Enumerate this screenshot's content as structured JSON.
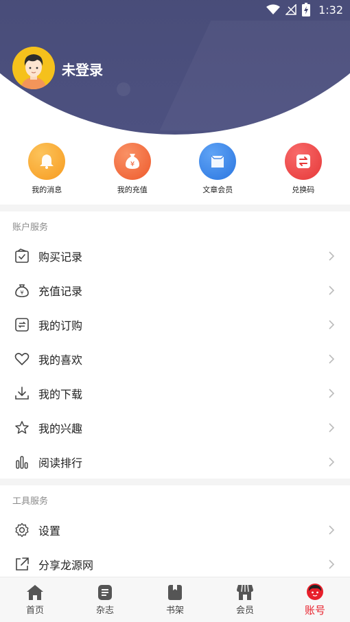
{
  "status": {
    "time": "1:32"
  },
  "profile": {
    "login_text": "未登录",
    "avatar_icon": "avatar-icon"
  },
  "quick": [
    {
      "label": "我的消息",
      "icon": "bell-icon",
      "color": "#f7a52b"
    },
    {
      "label": "我的充值",
      "icon": "money-bag-icon",
      "color": "#f3703a"
    },
    {
      "label": "文章会员",
      "icon": "bag-icon",
      "color": "#3d86e8"
    },
    {
      "label": "兑换码",
      "icon": "exchange-icon",
      "color": "#ef4b4b"
    }
  ],
  "sections": [
    {
      "title": "账户服务",
      "items": [
        {
          "label": "购买记录",
          "icon": "purchase-record-icon"
        },
        {
          "label": "充值记录",
          "icon": "recharge-record-icon"
        },
        {
          "label": "我的订购",
          "icon": "subscription-icon"
        },
        {
          "label": "我的喜欢",
          "icon": "heart-icon"
        },
        {
          "label": "我的下载",
          "icon": "download-icon"
        },
        {
          "label": "我的兴趣",
          "icon": "star-icon"
        },
        {
          "label": "阅读排行",
          "icon": "bar-chart-icon"
        }
      ]
    },
    {
      "title": "工具服务",
      "items": [
        {
          "label": "设置",
          "icon": "settings-icon"
        },
        {
          "label": "分享龙源网",
          "icon": "share-icon"
        }
      ]
    }
  ],
  "tabbar": [
    {
      "label": "首页",
      "icon": "home-icon"
    },
    {
      "label": "杂志",
      "icon": "magazine-icon"
    },
    {
      "label": "书架",
      "icon": "bookshelf-icon"
    },
    {
      "label": "会员",
      "icon": "member-icon"
    },
    {
      "label": "账号",
      "icon": "account-icon",
      "active": true
    }
  ],
  "colors": {
    "header": "#3f4270",
    "active": "#e8202b"
  }
}
